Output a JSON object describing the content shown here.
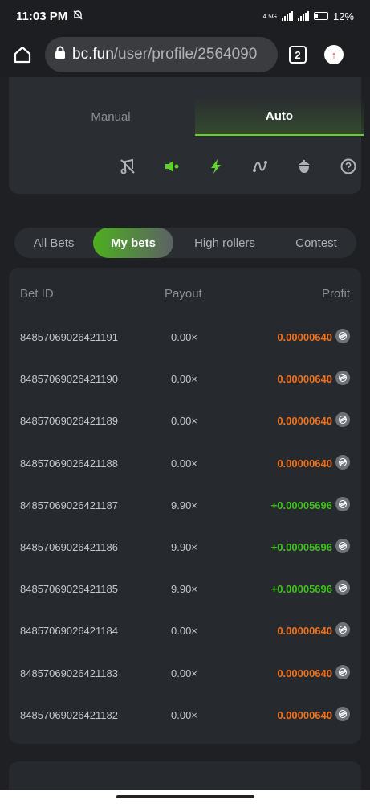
{
  "status": {
    "time": "11:03 PM",
    "network": "4.5G",
    "battery": "12%"
  },
  "browser": {
    "url_host": "bc.fun",
    "url_path": "/user/profile/2564090",
    "tab_count": "2"
  },
  "mode_tabs": {
    "manual": "Manual",
    "auto": "Auto"
  },
  "tools": [
    "music-off-icon",
    "sound-icon",
    "lightning-icon",
    "curve-icon",
    "acorn-icon",
    "help-icon"
  ],
  "bet_tabs": {
    "all": "All Bets",
    "my": "My bets",
    "high": "High rollers",
    "contest": "Contest"
  },
  "table": {
    "headers": {
      "id": "Bet ID",
      "payout": "Payout",
      "profit": "Profit"
    },
    "rows": [
      {
        "id": "84857069026421191",
        "payout": "0.00×",
        "profit": "0.00000640",
        "status": "loss"
      },
      {
        "id": "84857069026421190",
        "payout": "0.00×",
        "profit": "0.00000640",
        "status": "loss"
      },
      {
        "id": "84857069026421189",
        "payout": "0.00×",
        "profit": "0.00000640",
        "status": "loss"
      },
      {
        "id": "84857069026421188",
        "payout": "0.00×",
        "profit": "0.00000640",
        "status": "loss"
      },
      {
        "id": "84857069026421187",
        "payout": "9.90×",
        "profit": "+0.00005696",
        "status": "win"
      },
      {
        "id": "84857069026421186",
        "payout": "9.90×",
        "profit": "+0.00005696",
        "status": "win"
      },
      {
        "id": "84857069026421185",
        "payout": "9.90×",
        "profit": "+0.00005696",
        "status": "win"
      },
      {
        "id": "84857069026421184",
        "payout": "0.00×",
        "profit": "0.00000640",
        "status": "loss"
      },
      {
        "id": "84857069026421183",
        "payout": "0.00×",
        "profit": "0.00000640",
        "status": "loss"
      },
      {
        "id": "84857069026421182",
        "payout": "0.00×",
        "profit": "0.00000640",
        "status": "loss"
      }
    ]
  },
  "colors": {
    "accent": "#5fd32a",
    "loss": "#f2721c",
    "win": "#3fc31a"
  }
}
